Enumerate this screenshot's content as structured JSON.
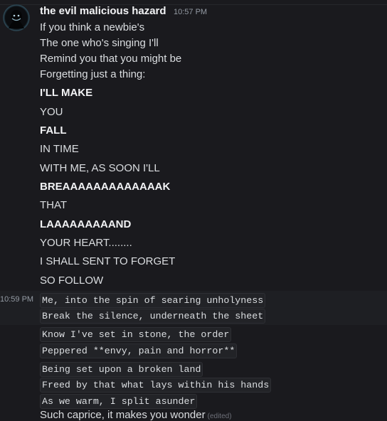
{
  "message": {
    "username": "the evil malicious hazard",
    "timestamp": "10:57 PM",
    "lines": [
      "If you think a newbie's",
      "The one who's singing I'll",
      "Remind you that you might be",
      "Forgetting just a thing:",
      "I'LL MAKE",
      "YOU",
      "FALL",
      "IN TIME",
      "WITH ME, AS SOON I'LL",
      "BREAAAAAAAAAAAAAK",
      "THAT",
      "LAAAAAAAAAND",
      "YOUR HEART........",
      "I SHALL SENT TO FORGET",
      "SO FOLLOW"
    ]
  },
  "followup": {
    "timestamp": "10:59 PM",
    "code_lines": [
      "Me, into the spin of searing unholyness",
      "Break the silence, underneath the sheet",
      "Know I've set in stone, the order",
      "Peppered **envy, pain and horror**",
      "Being set upon a broken land",
      "Freed by that what lays within his hands",
      "As we warm, I split asunder"
    ],
    "last_line": "Such caprice, it makes you wonder",
    "edited_label": "(edited)"
  },
  "colors": {
    "background": "#1a1a1e",
    "text": "#dbdee1",
    "muted": "#949ba4",
    "code_bg": "#222327"
  },
  "icons": {
    "avatar": "dark-hooded-figure-avatar"
  }
}
